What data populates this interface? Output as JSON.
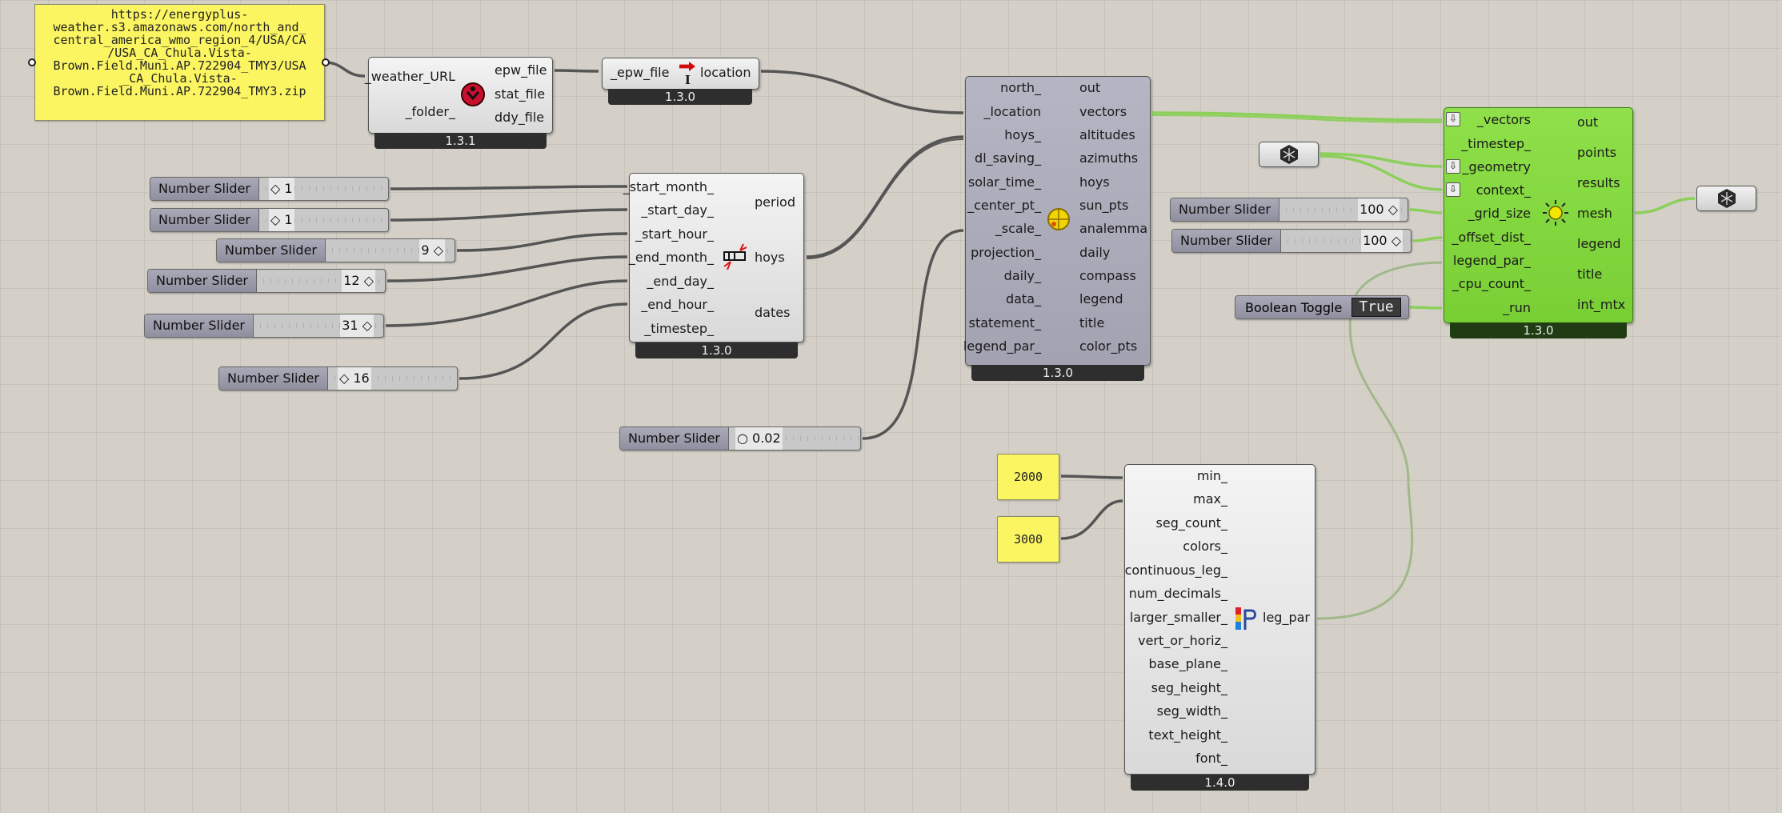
{
  "weather_url_panel": {
    "text": "https://energyplus-\nweather.s3.amazonaws.com/north_and_\ncentral_america_wmo_region_4/USA/CA\n/USA_CA_Chula.Vista-\nBrown.Field.Muni.AP.722904_TMY3/USA\n_CA_Chula.Vista-\nBrown.Field.Muni.AP.722904_TMY3.zip"
  },
  "download_weather": {
    "inputs": [
      "_weather_URL",
      "_folder_"
    ],
    "outputs": [
      "epw_file",
      "stat_file",
      "ddy_file"
    ],
    "icon": "download-weather-icon",
    "version": "1.3.1"
  },
  "import_location": {
    "inputs": [
      "_epw_file"
    ],
    "outputs": [
      "location"
    ],
    "icon_text": "I\nNY",
    "version": "1.3.0"
  },
  "analysis_period": {
    "inputs": [
      "_start_month_",
      "_start_day_",
      "_start_hour_",
      "_end_month_",
      "_end_day_",
      "_end_hour_",
      "_timestep_"
    ],
    "outputs": [
      "period",
      "hoys",
      "dates"
    ],
    "icon": "analysis-period-icon",
    "version": "1.3.0"
  },
  "sunpath": {
    "inputs": [
      "north_",
      "_location",
      "hoys_",
      "dl_saving_",
      "solar_time_",
      "_center_pt_",
      "_scale_",
      "projection_",
      "daily_",
      "data_",
      "statement_",
      "legend_par_"
    ],
    "outputs": [
      "out",
      "vectors",
      "altitudes",
      "azimuths",
      "hoys",
      "sun_pts",
      "analemma",
      "daily",
      "compass",
      "legend",
      "title",
      "color_pts"
    ],
    "icon": "sunpath-icon",
    "version": "1.3.0"
  },
  "direct_sun_hours": {
    "inputs": [
      "_vectors",
      "_timestep_",
      "_geometry",
      "context_",
      "_grid_size",
      "_offset_dist_",
      "legend_par_",
      "_cpu_count_",
      "_run"
    ],
    "outputs": [
      "out",
      "points",
      "results",
      "mesh",
      "legend",
      "title",
      "int_mtx"
    ],
    "icon": "sun-hours-icon",
    "version": "1.3.0"
  },
  "legend_parameters": {
    "inputs": [
      "min_",
      "max_",
      "seg_count_",
      "colors_",
      "continuous_leg_",
      "num_decimals_",
      "larger_smaller_",
      "vert_or_horiz_",
      "base_plane_",
      "seg_height_",
      "seg_width_",
      "text_height_",
      "font_"
    ],
    "outputs": [
      "leg_par"
    ],
    "icon": "legend-par-icon",
    "version": "1.4.0"
  },
  "sliders": [
    {
      "label": "Number Slider",
      "value": "1",
      "marker": "diamond"
    },
    {
      "label": "Number Slider",
      "value": "1",
      "marker": "diamond"
    },
    {
      "label": "Number Slider",
      "value": "9",
      "marker": "diamond"
    },
    {
      "label": "Number Slider",
      "value": "12",
      "marker": "diamond"
    },
    {
      "label": "Number Slider",
      "value": "31",
      "marker": "diamond"
    },
    {
      "label": "Number Slider",
      "value": "16",
      "marker": "diamond"
    },
    {
      "label": "Number Slider",
      "value": "0.02",
      "marker": "circle"
    },
    {
      "label": "Number Slider",
      "value": "100",
      "marker": "diamond"
    },
    {
      "label": "Number Slider",
      "value": "100",
      "marker": "diamond"
    }
  ],
  "boolean_toggle": {
    "label": "Boolean Toggle",
    "value": "True"
  },
  "min_panel": {
    "text": "2000"
  },
  "max_panel": {
    "text": "3000"
  },
  "geometry_params": [
    {
      "icon": "geometry-param-icon"
    },
    {
      "icon": "geometry-param-icon"
    }
  ],
  "colors": {
    "wire": "#555555",
    "wire_green": "#8ccf5a",
    "panel": "#fbf562",
    "green_component": "#86da42"
  }
}
